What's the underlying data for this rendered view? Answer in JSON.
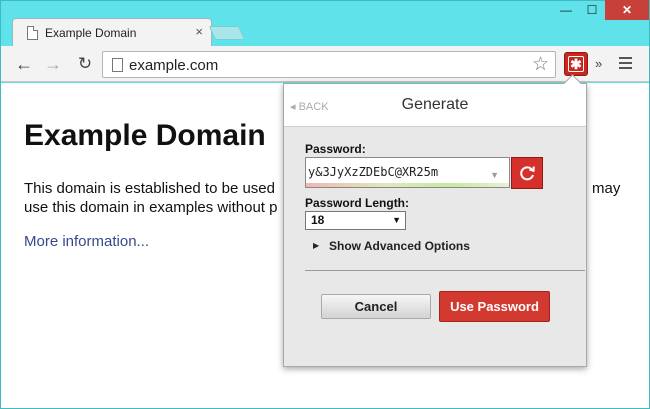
{
  "window": {
    "controls": {
      "minimize": "—",
      "maximize": "☐",
      "close": "✕"
    }
  },
  "tabs": [
    {
      "title": "Example Domain",
      "close": "×",
      "active": true
    }
  ],
  "toolbar": {
    "back_icon": "←",
    "forward_icon": "→",
    "reload_icon": "↻",
    "url": "example.com",
    "star_icon": "☆",
    "lastpass_icon": "✱",
    "extensions_overflow": "»"
  },
  "page": {
    "heading": "Example Domain",
    "line1": "This domain is established to be used",
    "line1_tail": "may",
    "line2": "use this domain in examples without p",
    "link": "More information..."
  },
  "popup": {
    "back_label": "◂ BACK",
    "title": "Generate",
    "password_label": "Password:",
    "password_value": "y&3JyXzZDEbC@XR25m",
    "length_label": "Password Length:",
    "length_value": "18",
    "advanced_caret": "▶",
    "advanced_label": "Show Advanced Options",
    "cancel_label": "Cancel",
    "use_label": "Use Password"
  },
  "colors": {
    "frame": "#60e2ea",
    "accent_red": "#d33a2f",
    "link": "#38488f"
  }
}
